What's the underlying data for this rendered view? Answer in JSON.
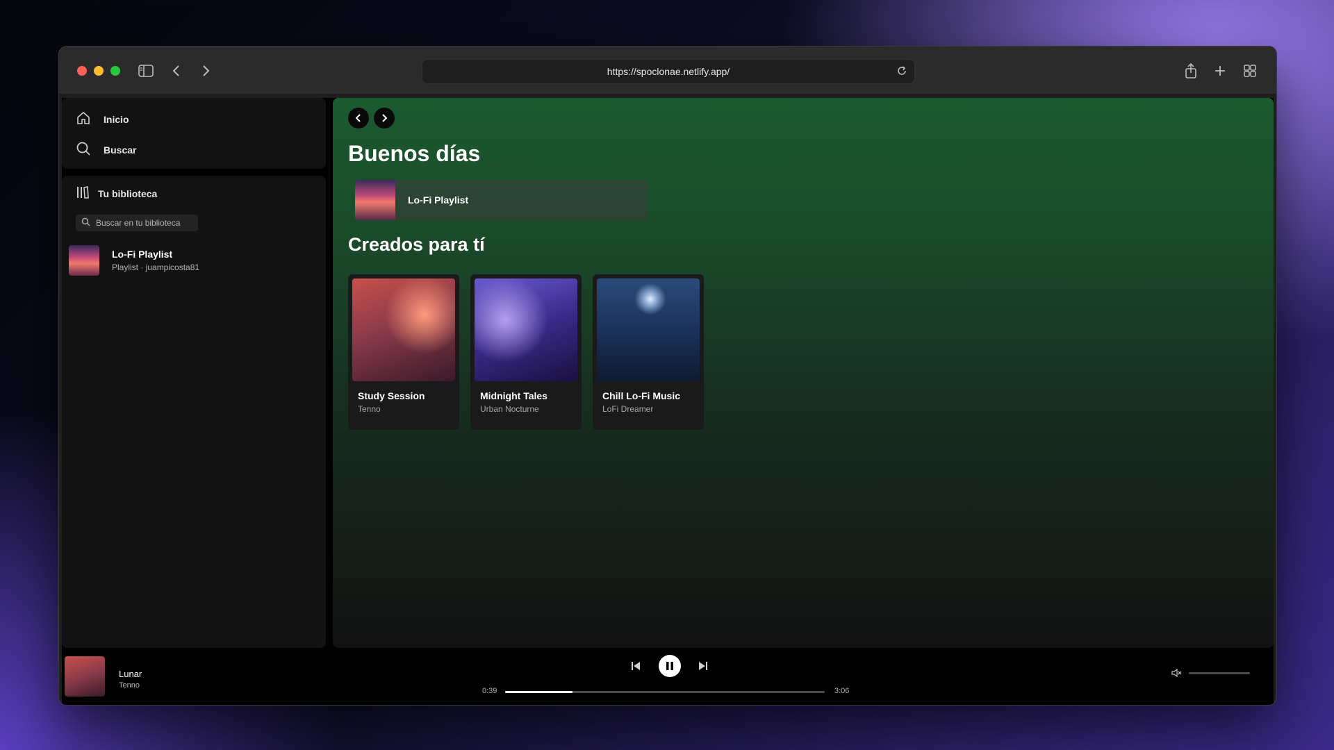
{
  "browser": {
    "url": "https://spoclonae.netlify.app/",
    "traffic_lights": [
      "#ff5f57",
      "#febc2e",
      "#28c840"
    ]
  },
  "sidebar": {
    "nav": [
      {
        "label": "Inicio",
        "icon": "home-icon"
      },
      {
        "label": "Buscar",
        "icon": "search-icon"
      }
    ],
    "library": {
      "title": "Tu biblioteca",
      "search_placeholder": "Buscar en tu biblioteca",
      "items": [
        {
          "name": "Lo-Fi Playlist",
          "subtitle": "Playlist · juampicosta81"
        }
      ]
    }
  },
  "main": {
    "greeting": "Buenos días",
    "quick_items": [
      {
        "label": "Lo-Fi Playlist"
      }
    ],
    "section_title": "Creados para tí",
    "cards": [
      {
        "title": "Study Session",
        "artist": "Tenno"
      },
      {
        "title": "Midnight Tales",
        "artist": "Urban Nocturne"
      },
      {
        "title": "Chill Lo-Fi Music",
        "artist": "LoFi Dreamer"
      }
    ]
  },
  "player": {
    "track_title": "Lunar",
    "track_artist": "Tenno",
    "elapsed": "0:39",
    "duration": "3:06",
    "progress": 0.21,
    "volume": 0
  },
  "colors": {
    "accent_green": "#1b5a2f",
    "background": "#121212"
  }
}
